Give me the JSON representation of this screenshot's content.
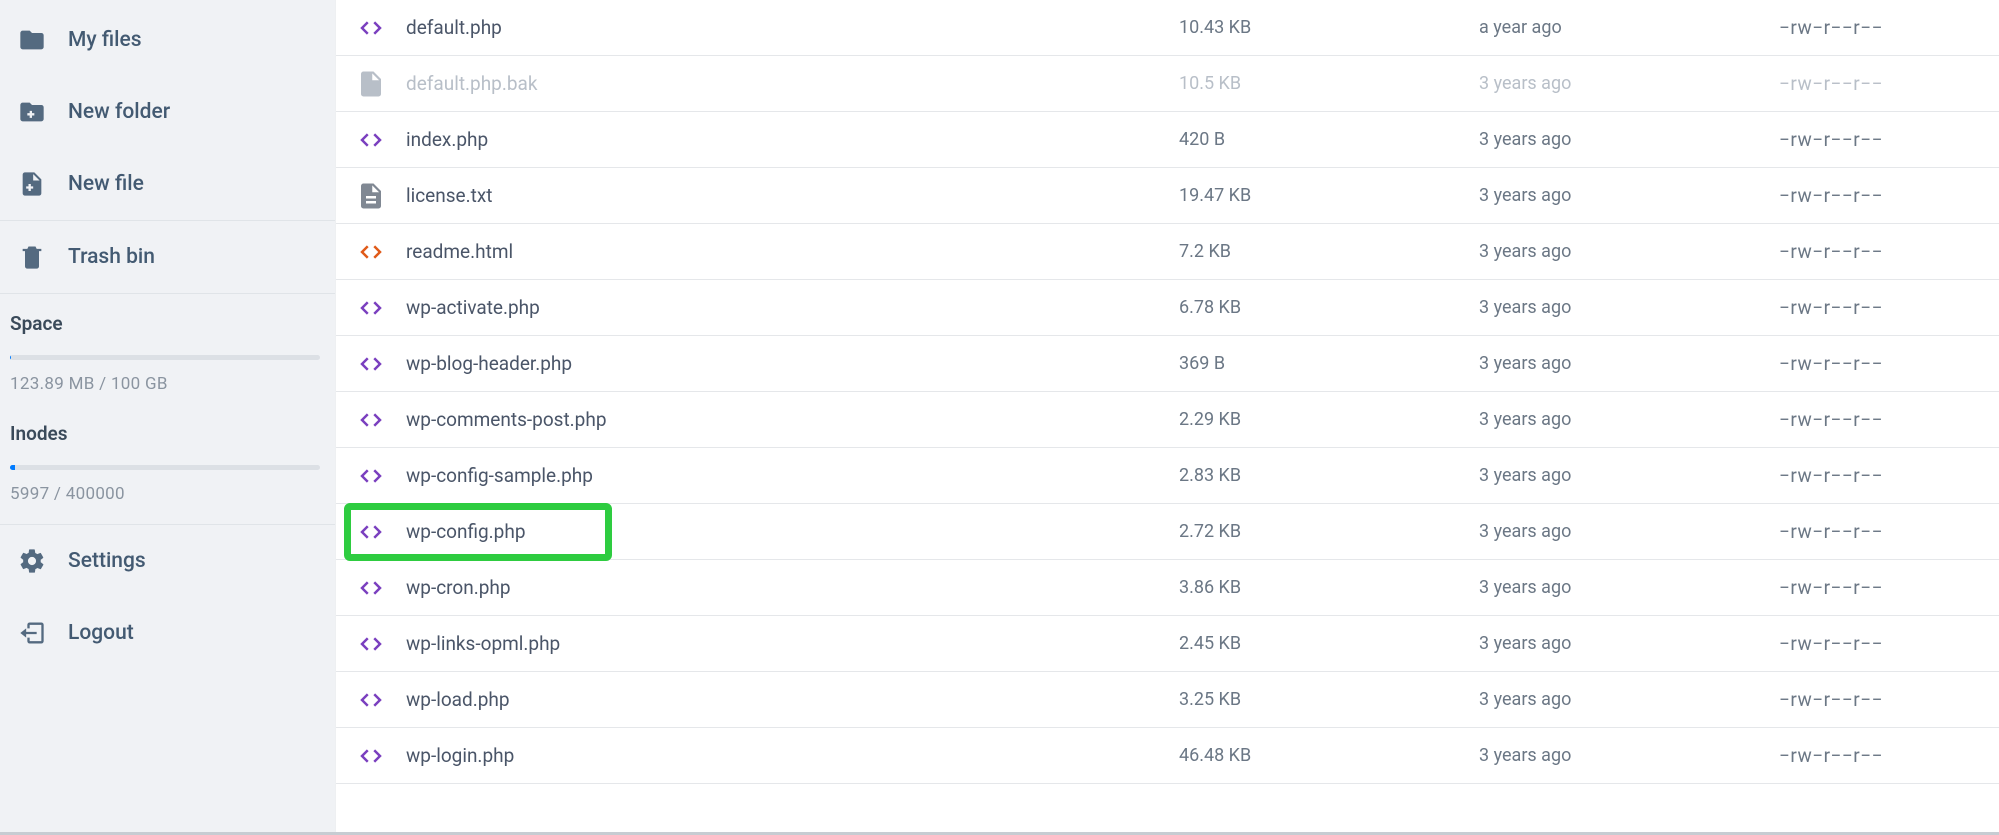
{
  "sidebar": {
    "items": [
      {
        "label": "My files",
        "icon": "folder-icon"
      },
      {
        "label": "New folder",
        "icon": "folder-plus-icon"
      },
      {
        "label": "New file",
        "icon": "file-plus-icon"
      },
      {
        "label": "Trash bin",
        "icon": "trash-icon"
      },
      {
        "label": "Settings",
        "icon": "gear-icon"
      },
      {
        "label": "Logout",
        "icon": "logout-icon"
      }
    ],
    "space": {
      "title": "Space",
      "value": "123.89 MB / 100 GB",
      "percent": 0.12
    },
    "inodes": {
      "title": "Inodes",
      "value": "5997 / 400000",
      "percent": 1.5
    }
  },
  "files": [
    {
      "name": "default.php",
      "size": "10.43 KB",
      "modified": "a year ago",
      "perm": "−rw−r−−r−−",
      "icon": "code-icon",
      "icon_color": "ic-purple",
      "dimmed": false,
      "highlight": false
    },
    {
      "name": "default.php.bak",
      "size": "10.5 KB",
      "modified": "3 years ago",
      "perm": "−rw−r−−r−−",
      "icon": "file-icon",
      "icon_color": "ic-lgrey",
      "dimmed": true,
      "highlight": false
    },
    {
      "name": "index.php",
      "size": "420 B",
      "modified": "3 years ago",
      "perm": "−rw−r−−r−−",
      "icon": "code-icon",
      "icon_color": "ic-purple",
      "dimmed": false,
      "highlight": false
    },
    {
      "name": "license.txt",
      "size": "19.47 KB",
      "modified": "3 years ago",
      "perm": "−rw−r−−r−−",
      "icon": "file-text-icon",
      "icon_color": "ic-grey",
      "dimmed": false,
      "highlight": false
    },
    {
      "name": "readme.html",
      "size": "7.2 KB",
      "modified": "3 years ago",
      "perm": "−rw−r−−r−−",
      "icon": "code-icon",
      "icon_color": "ic-orange",
      "dimmed": false,
      "highlight": false
    },
    {
      "name": "wp-activate.php",
      "size": "6.78 KB",
      "modified": "3 years ago",
      "perm": "−rw−r−−r−−",
      "icon": "code-icon",
      "icon_color": "ic-purple",
      "dimmed": false,
      "highlight": false
    },
    {
      "name": "wp-blog-header.php",
      "size": "369 B",
      "modified": "3 years ago",
      "perm": "−rw−r−−r−−",
      "icon": "code-icon",
      "icon_color": "ic-purple",
      "dimmed": false,
      "highlight": false
    },
    {
      "name": "wp-comments-post.php",
      "size": "2.29 KB",
      "modified": "3 years ago",
      "perm": "−rw−r−−r−−",
      "icon": "code-icon",
      "icon_color": "ic-purple",
      "dimmed": false,
      "highlight": false
    },
    {
      "name": "wp-config-sample.php",
      "size": "2.83 KB",
      "modified": "3 years ago",
      "perm": "−rw−r−−r−−",
      "icon": "code-icon",
      "icon_color": "ic-purple",
      "dimmed": false,
      "highlight": false
    },
    {
      "name": "wp-config.php",
      "size": "2.72 KB",
      "modified": "3 years ago",
      "perm": "−rw−r−−r−−",
      "icon": "code-icon",
      "icon_color": "ic-purple",
      "dimmed": false,
      "highlight": true
    },
    {
      "name": "wp-cron.php",
      "size": "3.86 KB",
      "modified": "3 years ago",
      "perm": "−rw−r−−r−−",
      "icon": "code-icon",
      "icon_color": "ic-purple",
      "dimmed": false,
      "highlight": false
    },
    {
      "name": "wp-links-opml.php",
      "size": "2.45 KB",
      "modified": "3 years ago",
      "perm": "−rw−r−−r−−",
      "icon": "code-icon",
      "icon_color": "ic-purple",
      "dimmed": false,
      "highlight": false
    },
    {
      "name": "wp-load.php",
      "size": "3.25 KB",
      "modified": "3 years ago",
      "perm": "−rw−r−−r−−",
      "icon": "code-icon",
      "icon_color": "ic-purple",
      "dimmed": false,
      "highlight": false
    },
    {
      "name": "wp-login.php",
      "size": "46.48 KB",
      "modified": "3 years ago",
      "perm": "−rw−r−−r−−",
      "icon": "code-icon",
      "icon_color": "ic-purple",
      "dimmed": false,
      "highlight": false
    }
  ]
}
